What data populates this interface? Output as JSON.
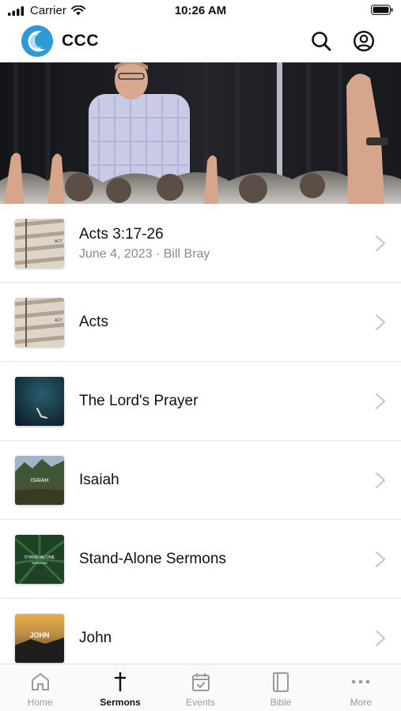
{
  "status_bar": {
    "carrier": "Carrier",
    "time": "10:26 AM"
  },
  "header": {
    "app_title": "CCC",
    "logo_icon": "church-wave-logo",
    "search_icon": "search-icon",
    "account_icon": "account-circle-icon"
  },
  "sermons": [
    {
      "title": "Acts 3:17-26",
      "subtitle": "June 4, 2023 · Bill Bray",
      "thumb_text": "ACT"
    },
    {
      "title": "Acts",
      "subtitle": "",
      "thumb_text": "ACT"
    },
    {
      "title": "The Lord's Prayer",
      "subtitle": "",
      "thumb_text": ""
    },
    {
      "title": "Isaiah",
      "subtitle": "",
      "thumb_text": "ISAIAH"
    },
    {
      "title": "Stand-Alone Sermons",
      "subtitle": "",
      "thumb_text": "STAND-ALONE",
      "thumb_text2": "SERMONS"
    },
    {
      "title": "John",
      "subtitle": "",
      "thumb_text": "JOHN"
    }
  ],
  "tabs": [
    {
      "label": "Home",
      "icon": "home-icon",
      "active": false
    },
    {
      "label": "Sermons",
      "icon": "cross-icon",
      "active": true
    },
    {
      "label": "Events",
      "icon": "calendar-check-icon",
      "active": false
    },
    {
      "label": "Bible",
      "icon": "book-icon",
      "active": false
    },
    {
      "label": "More",
      "icon": "more-dots-icon",
      "active": false
    }
  ],
  "colors": {
    "brand_blue": "#2f9bd6",
    "tab_active": "#111111",
    "tab_inactive": "#9a9a9a",
    "subtitle_gray": "#8a8a8a"
  }
}
